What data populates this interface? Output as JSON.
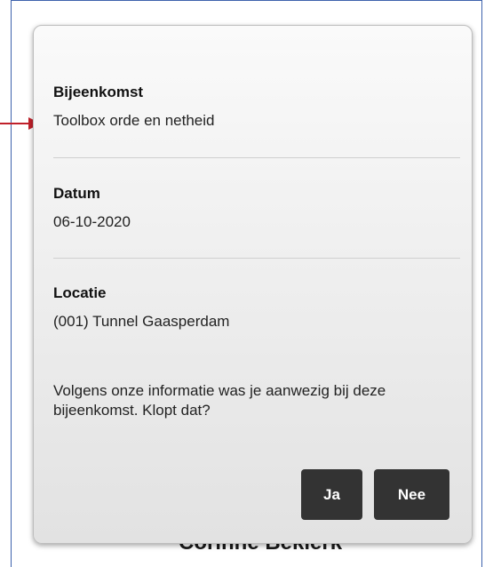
{
  "background_text": "Corinne Beklerk",
  "dialog": {
    "fields": [
      {
        "label": "Bijeenkomst",
        "value": "Toolbox orde en netheid"
      },
      {
        "label": "Datum",
        "value": "06-10-2020"
      },
      {
        "label": "Locatie",
        "value": "(001) Tunnel Gaasperdam"
      }
    ],
    "question": "Volgens onze informatie was je aanwezig bij deze bijeenkomst. Klopt dat?",
    "buttons": {
      "yes": "Ja",
      "no": "Nee"
    }
  },
  "colors": {
    "frame_border": "#3e63ad",
    "arrow": "#c0202a",
    "button_bg": "#333333",
    "button_text": "#ffffff"
  }
}
